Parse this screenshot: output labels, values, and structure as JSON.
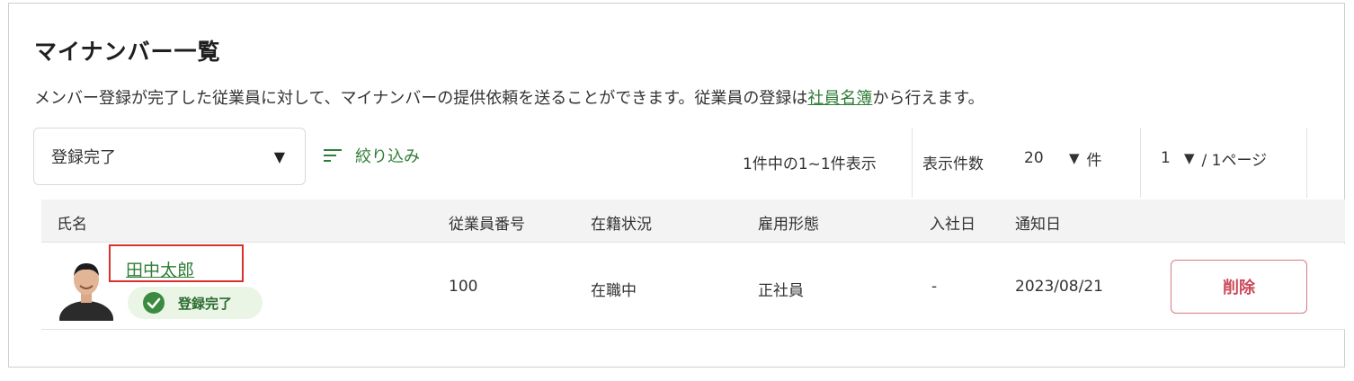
{
  "header": {
    "title": "マイナンバー一覧",
    "description_before": "メンバー登録が完了した従業員に対して、マイナンバーの提供依頼を送ることができます。従業員の登録は",
    "description_link": "社員名簿",
    "description_after": "から行えます。"
  },
  "toolbar": {
    "status_filter_value": "登録完了",
    "filter_label": "絞り込み",
    "count_text": "1件中の1~1件表示",
    "per_page_label": "表示件数",
    "per_page_value": "20",
    "per_page_unit": "件",
    "page_value": "1",
    "page_total": "/ 1ページ"
  },
  "table": {
    "headers": {
      "name": "氏名",
      "employee_no": "従業員番号",
      "status": "在籍状況",
      "employment_type": "雇用形態",
      "join_date": "入社日",
      "notice_date": "通知日"
    },
    "rows": [
      {
        "name": "田中太郎",
        "badge": "登録完了",
        "employee_no": "100",
        "status": "在職中",
        "employment_type": "正社員",
        "join_date": "-",
        "notice_date": "2023/08/21",
        "delete_label": "削除"
      }
    ]
  },
  "colors": {
    "accent_green": "#2f7d36",
    "badge_bg": "#eaf5e6",
    "delete_red": "#cc4a5a",
    "highlight_red": "#d9302c"
  },
  "icons": {
    "caret": "▼",
    "filter": "filter-lines-icon",
    "check": "check-circle-icon"
  }
}
